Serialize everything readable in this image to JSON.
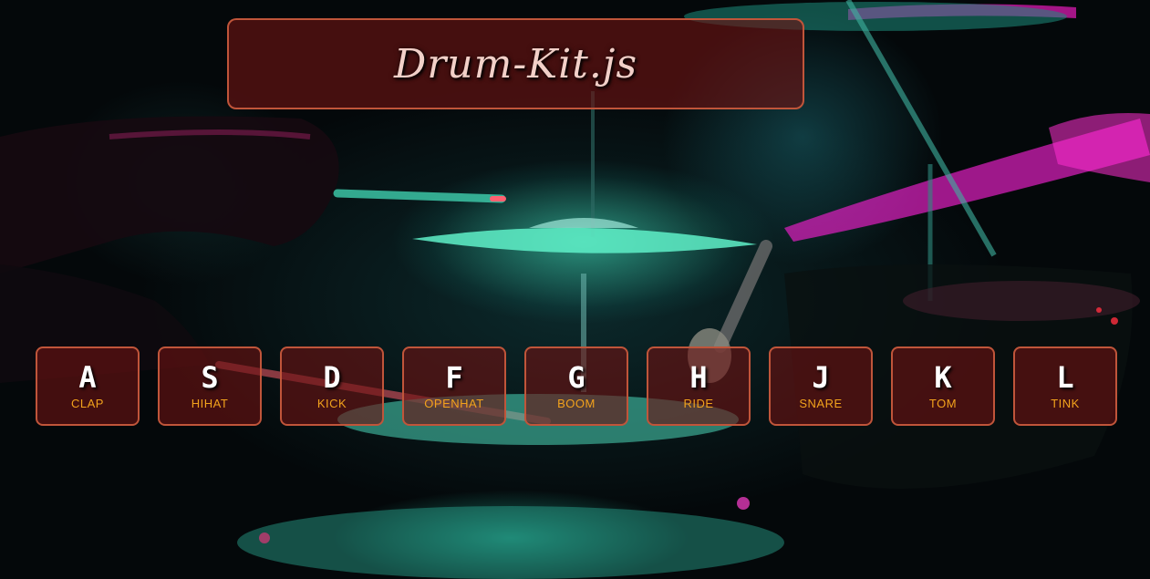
{
  "app": {
    "title": "Drum-Kit.js"
  },
  "keys": [
    {
      "key": "A",
      "sound": "CLAP"
    },
    {
      "key": "S",
      "sound": "HIHAT"
    },
    {
      "key": "D",
      "sound": "KICK"
    },
    {
      "key": "F",
      "sound": "OPENHAT"
    },
    {
      "key": "G",
      "sound": "BOOM"
    },
    {
      "key": "H",
      "sound": "RIDE"
    },
    {
      "key": "J",
      "sound": "SNARE"
    },
    {
      "key": "K",
      "sound": "TOM"
    },
    {
      "key": "L",
      "sound": "TINK"
    }
  ],
  "colors": {
    "accent_border": "#c0553a",
    "key_letter": "#ffffff",
    "sound_label": "#f2a21c",
    "panel_fill": "#6e1414",
    "cymbal_glow": "#46f0c8",
    "stage_light": "#e020c0"
  }
}
